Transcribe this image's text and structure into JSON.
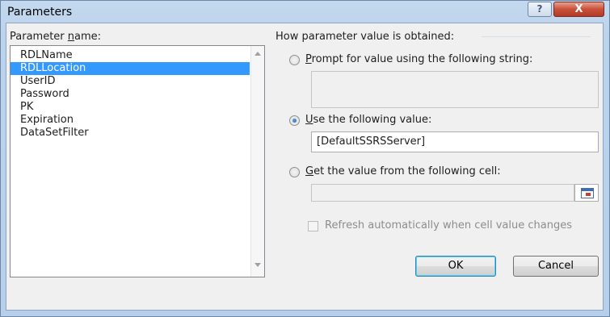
{
  "window": {
    "title": "Parameters",
    "help_glyph": "?",
    "close_glyph": "X"
  },
  "param_list": {
    "label_before": "Parameter ",
    "label_accel": "n",
    "label_after": "ame:",
    "items": [
      "RDLName",
      "RDLLocation",
      "UserID",
      "Password",
      "PK",
      "Expiration",
      "DataSetFilter"
    ],
    "selected_index": 1
  },
  "how_obtained": {
    "label": "How parameter value is obtained:",
    "prompt": {
      "accel": "P",
      "rest": "rompt for value using the following string:",
      "value": "",
      "checked": false
    },
    "use_value": {
      "accel": "U",
      "rest": "se the following value:",
      "value": "[DefaultSSRSServer]",
      "checked": true
    },
    "from_cell": {
      "accel": "G",
      "rest": "et the value from the following cell:",
      "value": "",
      "checked": false
    },
    "refresh": {
      "label": "Refresh automatically when cell value changes",
      "checked": false,
      "enabled": false
    }
  },
  "buttons": {
    "ok": "OK",
    "cancel": "Cancel"
  }
}
